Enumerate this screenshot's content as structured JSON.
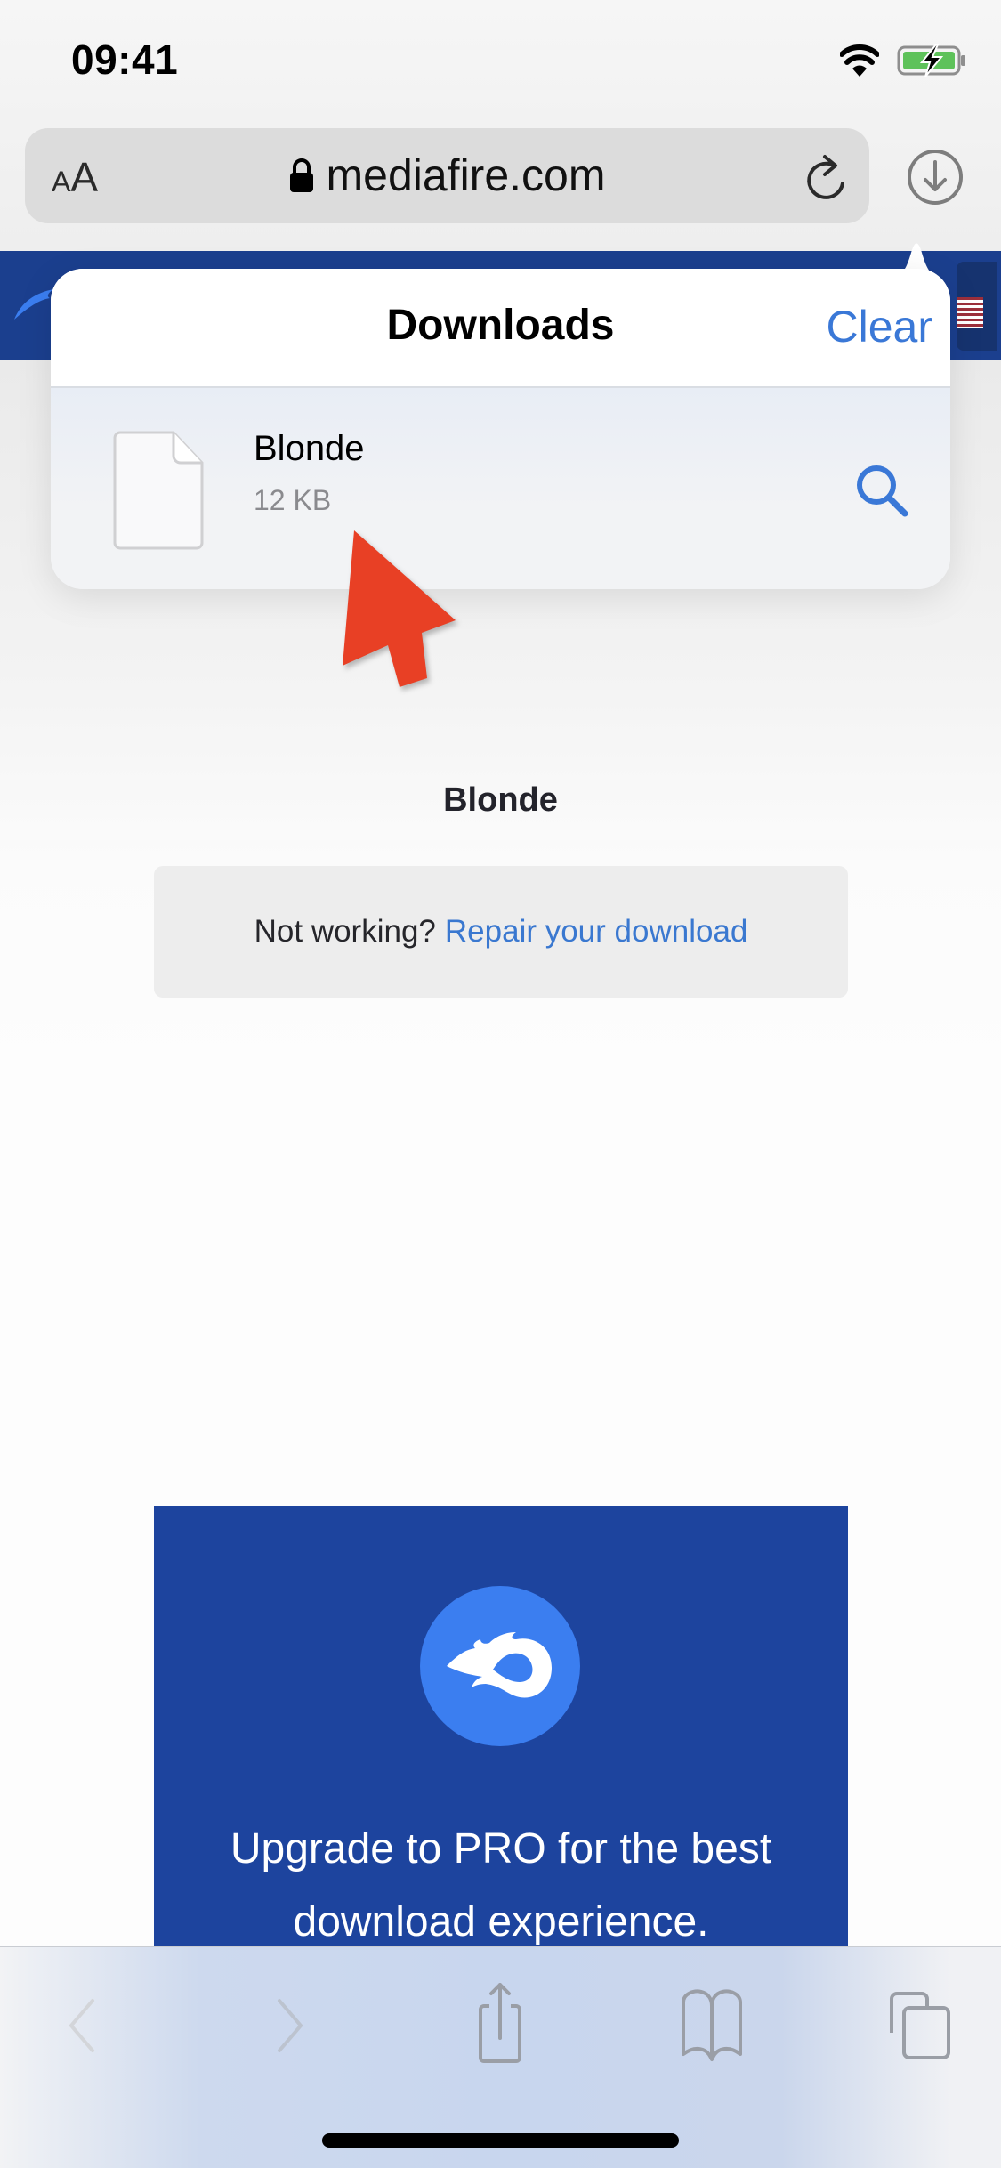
{
  "status_bar": {
    "time": "09:41",
    "wifi_icon": "wifi-icon",
    "battery_icon": "battery-charging-icon",
    "battery_color": "#5ec25a"
  },
  "address_bar": {
    "text_size_small": "A",
    "text_size_large": "A",
    "url": "mediafire.com",
    "lock_icon": "lock-icon",
    "reload_icon": "reload-icon",
    "downloads_icon": "downloads-arrow-circle-icon"
  },
  "downloads_popover": {
    "title": "Downloads",
    "clear_label": "Clear",
    "items": [
      {
        "name": "Blonde",
        "size": "12 KB",
        "icon": "document-icon",
        "action_icon": "magnifier-icon"
      }
    ]
  },
  "page": {
    "file_title": "Blonde",
    "repair_prompt": "Not working?",
    "repair_link": "Repair your download",
    "pro_banner": {
      "line1": "Upgrade to PRO for the best",
      "line2": "download experience."
    }
  },
  "toolbar": {
    "items": [
      {
        "name": "back",
        "icon": "chevron-left-icon",
        "enabled": false
      },
      {
        "name": "forward",
        "icon": "chevron-right-icon",
        "enabled": false
      },
      {
        "name": "share",
        "icon": "share-icon",
        "enabled": true
      },
      {
        "name": "bookmarks",
        "icon": "book-icon",
        "enabled": true
      },
      {
        "name": "tabs",
        "icon": "tabs-icon",
        "enabled": true
      }
    ]
  },
  "colors": {
    "accent_blue": "#3a78d7",
    "site_header_blue": "#1b3f8e",
    "pro_banner_blue": "#1d449e",
    "logo_circle_blue": "#3b7ef0",
    "annotation_red": "#e84025"
  }
}
